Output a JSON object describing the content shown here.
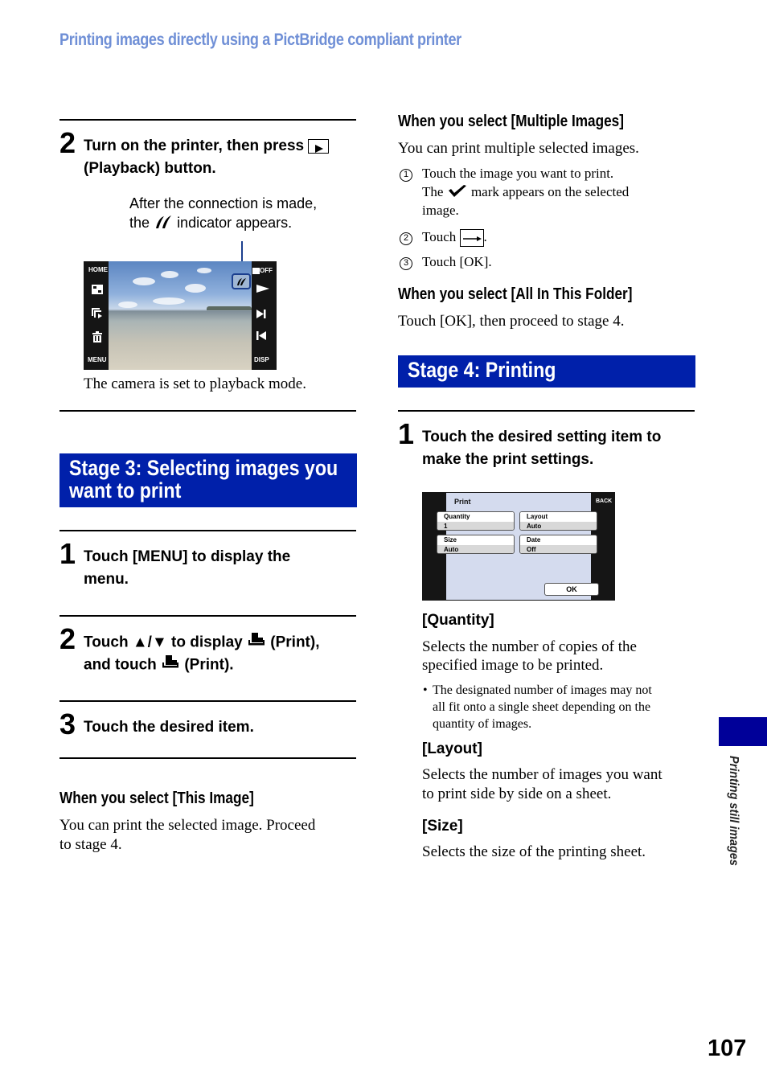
{
  "header": {
    "title": "Printing images directly using a PictBridge compliant printer"
  },
  "left": {
    "step2_connect": {
      "num": "2",
      "line1": "Turn on the printer, then press",
      "line2": "(Playback) button.",
      "note_line1": "After the connection is made,",
      "note_before": "the",
      "note_after": "indicator appears.",
      "caption": "The camera is set to playback mode."
    },
    "camera_screen": {
      "left_labels": [
        "HOME",
        "MENU"
      ],
      "right_labels": [
        "OFF",
        "DISP"
      ],
      "icons": [
        "index-icon",
        "slideshow-icon",
        "trash-icon",
        "play-icon",
        "next-icon",
        "prev-icon"
      ]
    },
    "stage3": {
      "title_line1": "Stage 3: Selecting images you",
      "title_line2": "want to print"
    },
    "step1": {
      "num": "1",
      "line1": "Touch [MENU] to display the",
      "line2": "menu."
    },
    "step2": {
      "num": "2",
      "line1_a": "Touch ▲/▼ to display",
      "line1_b": "(Print),",
      "line2_a": "and touch",
      "line2_b": "(Print)."
    },
    "step3": {
      "num": "3",
      "text": "Touch the desired item."
    },
    "this_image": {
      "heading": "When you select [This Image]",
      "line1": "You can print the selected image. Proceed",
      "line2": "to stage 4."
    }
  },
  "right": {
    "multiple": {
      "heading": "When you select [Multiple Images]",
      "intro": "You can print multiple selected images.",
      "items": [
        {
          "num": "1",
          "line1": "Touch the image you want to print.",
          "line2_a": "The",
          "line2_b": "mark appears on the selected",
          "line3": "image."
        },
        {
          "num": "2",
          "text_a": "Touch",
          "text_b": "."
        },
        {
          "num": "3",
          "text": "Touch [OK]."
        }
      ]
    },
    "all_folder": {
      "heading": "When you select [All In This Folder]",
      "text": "Touch [OK], then proceed to stage 4."
    },
    "stage4": {
      "title": "Stage 4: Printing"
    },
    "step1": {
      "num": "1",
      "line1": "Touch the desired setting item to",
      "line2": "make the print settings."
    },
    "print_screen": {
      "title": "Print",
      "back": "BACK",
      "settings": [
        {
          "label": "Quantity",
          "value": "1"
        },
        {
          "label": "Layout",
          "value": "Auto"
        },
        {
          "label": "Size",
          "value": "Auto"
        },
        {
          "label": "Date",
          "value": "Off"
        }
      ],
      "ok": "OK"
    },
    "quantity": {
      "heading": "[Quantity]",
      "line1": "Selects the number of copies of the",
      "line2": "specified image to be printed.",
      "note_line1": "The designated number of images may not",
      "note_line2": "all fit onto a single sheet depending on the",
      "note_line3": "quantity of images."
    },
    "layout": {
      "heading": "[Layout]",
      "line1": "Selects the number of images you want",
      "line2": "to print side by side on a sheet."
    },
    "size": {
      "heading": "[Size]",
      "text": "Selects the size of the printing sheet."
    }
  },
  "side_tab": {
    "label": "Printing still images",
    "color": "#000099"
  },
  "page_number": "107",
  "colors": {
    "stage_bar": "#0020aa",
    "header": "#6f8fd6"
  }
}
